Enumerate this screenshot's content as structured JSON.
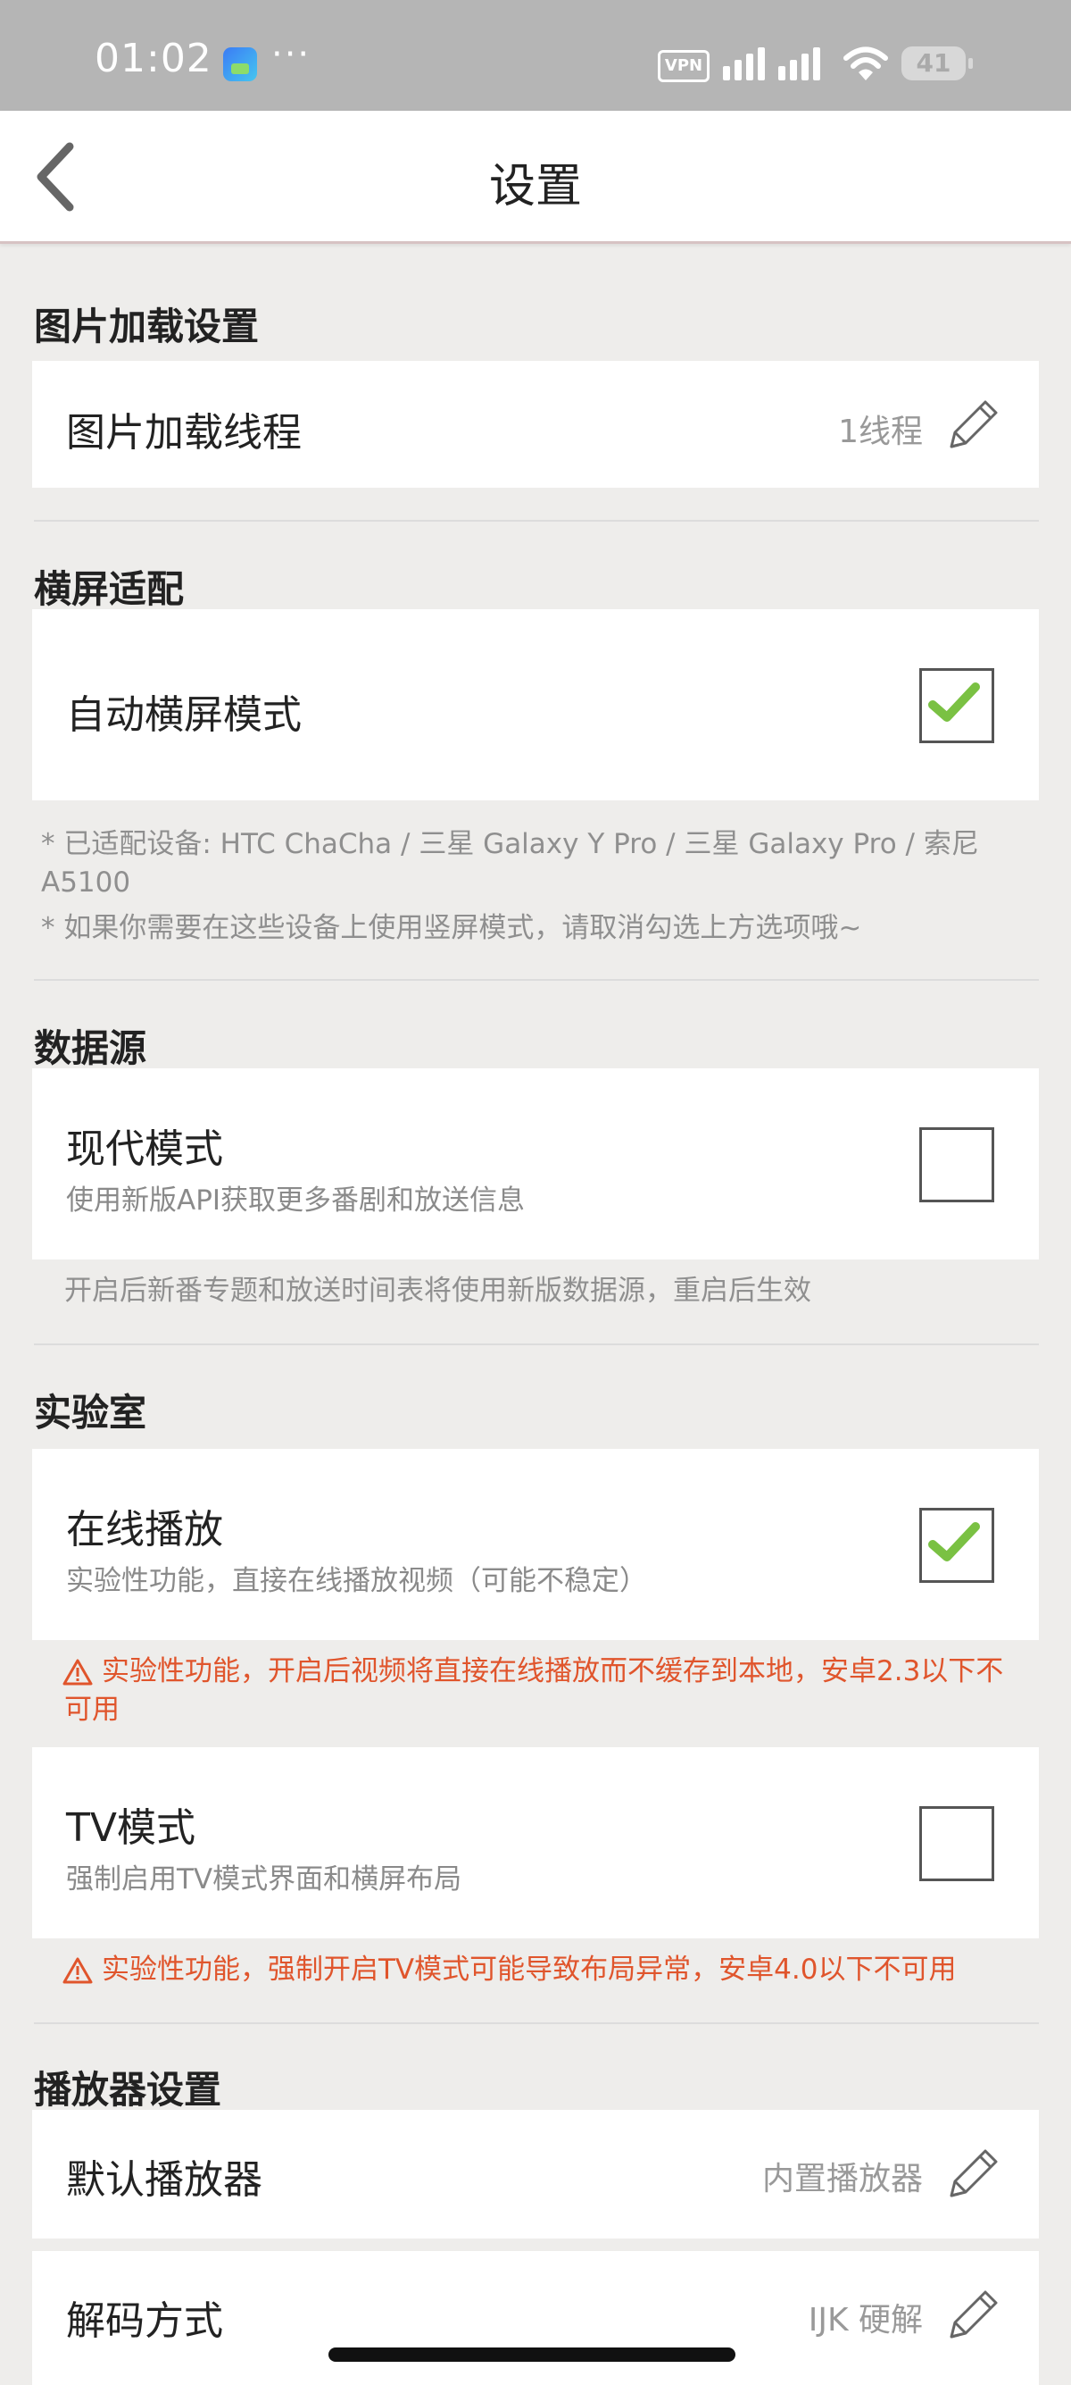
{
  "status_bar": {
    "time": "01:02",
    "dots": "···",
    "vpn": "VPN",
    "battery": "41"
  },
  "header": {
    "title": "设置"
  },
  "sections": {
    "image_loading": {
      "title": "图片加载设置",
      "threads": {
        "label": "图片加载线程",
        "value": "1线程"
      }
    },
    "landscape": {
      "title": "横屏适配",
      "auto_landscape": {
        "label": "自动横屏模式",
        "checked": true
      },
      "note1": "* 已适配设备: HTC ChaCha / 三星 Galaxy Y Pro / 三星 Galaxy Pro / 索尼 A5100",
      "note2": "* 如果你需要在这些设备上使用竖屏模式，请取消勾选上方选项哦~"
    },
    "data_source": {
      "title": "数据源",
      "modern_mode": {
        "label": "现代模式",
        "sub": "使用新版API获取更多番剧和放送信息",
        "checked": false
      },
      "note": "开启后新番专题和放送时间表将使用新版数据源，重启后生效"
    },
    "lab": {
      "title": "实验室",
      "online_play": {
        "label": "在线播放",
        "sub": "实验性功能，直接在线播放视频（可能不稳定）",
        "checked": true
      },
      "online_warn": "实验性功能，开启后视频将直接在线播放而不缓存到本地，安卓2.3以下不可用",
      "tv_mode": {
        "label": "TV模式",
        "sub": "强制启用TV模式界面和横屏布局",
        "checked": false
      },
      "tv_warn": "实验性功能，强制开启TV模式可能导致布局异常，安卓4.0以下不可用"
    },
    "player": {
      "title": "播放器设置",
      "default_player": {
        "label": "默认播放器",
        "value": "内置播放器"
      },
      "decoder": {
        "label": "解码方式",
        "value": "IJK 硬解"
      }
    }
  },
  "colors": {
    "accent_check": "#7ac143",
    "warn": "#e0552c",
    "background": "#eeedeb"
  }
}
